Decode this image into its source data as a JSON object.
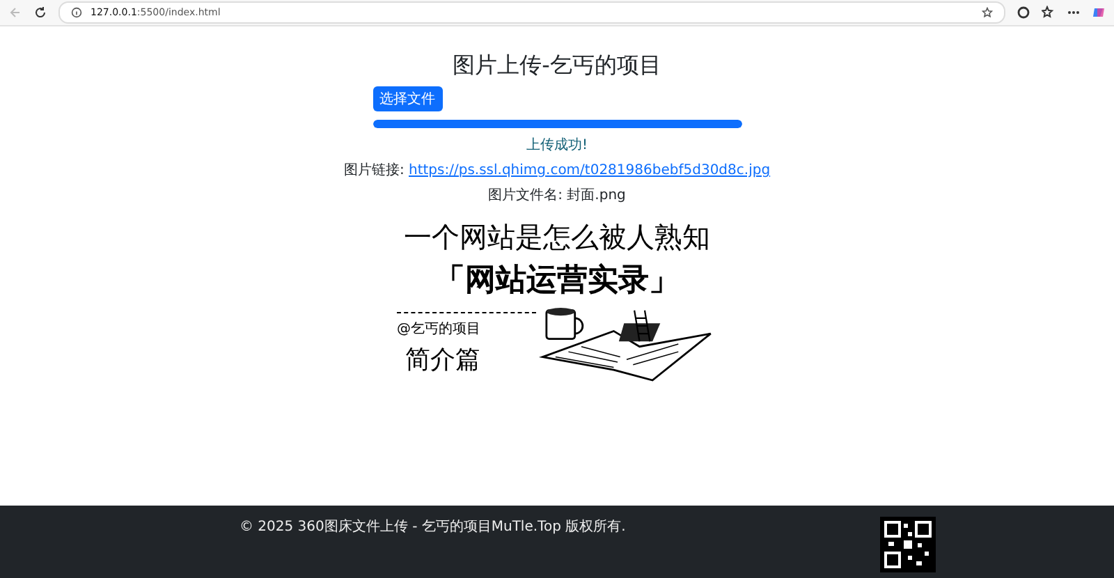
{
  "browser": {
    "url_host": "127.0.0.1",
    "url_path": ":5500/index.html"
  },
  "page": {
    "title": "图片上传-乞丐的项目",
    "file_button": "选择文件",
    "upload": {
      "level": 1
    },
    "status": "上传成功!",
    "link_label": "图片链接:",
    "link": "https://ps.ssl.qhimg.com/t0281986bebf5d30d8c.jpg",
    "filename_label": "图片文件名:",
    "filename": "封面.png"
  },
  "image": {
    "headline": "一个网站是怎么被人熟知",
    "title": "「网站运营实录」",
    "author": "@乞丐的项目",
    "subtitle": "简介篇"
  },
  "footer": {
    "copyright": "© 2025 360图床文件上传 - 乞丐的项目MuTle.Top 版权所有."
  }
}
